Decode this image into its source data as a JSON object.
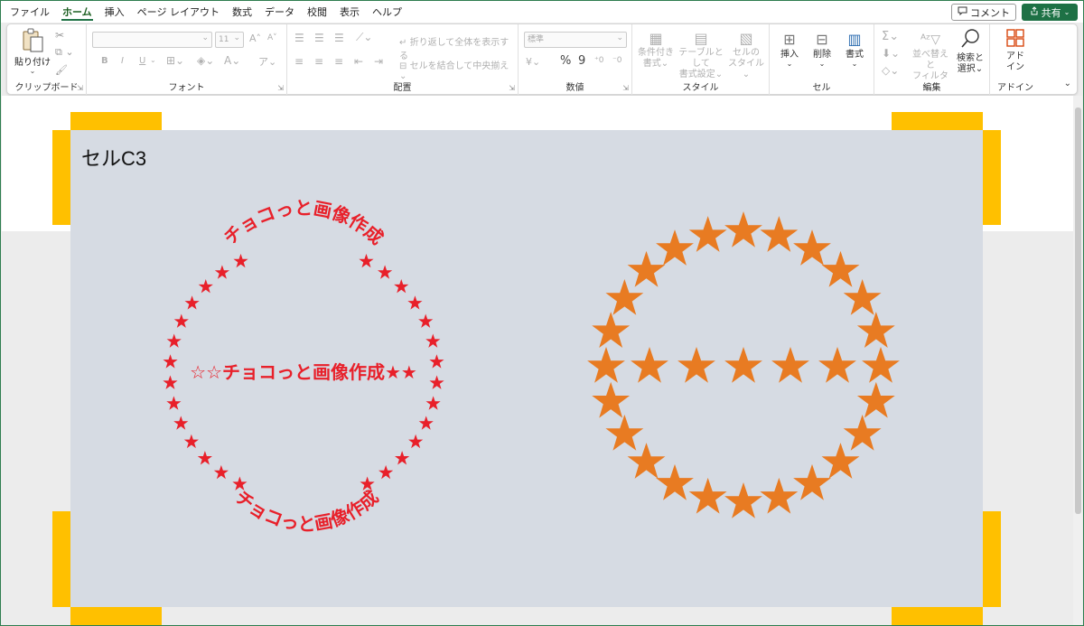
{
  "menu": {
    "tabs": [
      {
        "label": "ファイル"
      },
      {
        "label": "ホーム"
      },
      {
        "label": "挿入"
      },
      {
        "label": "ページ レイアウト"
      },
      {
        "label": "数式"
      },
      {
        "label": "データ"
      },
      {
        "label": "校閲"
      },
      {
        "label": "表示"
      },
      {
        "label": "ヘルプ"
      }
    ],
    "active_tab": "ホーム",
    "comment_label": "コメント",
    "share_label": "共有"
  },
  "ribbon": {
    "clipboard": {
      "paste_label": "貼り付け",
      "group_label": "クリップボード"
    },
    "font": {
      "font_size": "11",
      "bold": "B",
      "italic": "I",
      "underline": "U",
      "grow": "A",
      "shrink": "A",
      "group_label": "フォント"
    },
    "alignment": {
      "wrap_label": "折り返して全体を表示する",
      "merge_label": "セルを結合して中央揃え",
      "group_label": "配置"
    },
    "number": {
      "format": "標準",
      "percent": "%",
      "comma": "9",
      "group_label": "数値"
    },
    "styles": {
      "conditional_label_1": "条件付き",
      "conditional_label_2": "書式",
      "table_label_1": "テーブルとして",
      "table_label_2": "書式設定",
      "cell_styles_label_1": "セルの",
      "cell_styles_label_2": "スタイル",
      "group_label": "スタイル"
    },
    "cells": {
      "insert_label": "挿入",
      "delete_label": "削除",
      "format_label": "書式",
      "group_label": "セル"
    },
    "editing": {
      "sort_label_1": "並べ替えと",
      "sort_label_2": "フィルター",
      "find_label_1": "検索と",
      "find_label_2": "選択",
      "group_label": "編集"
    },
    "addins": {
      "label_1": "アド",
      "label_2": "イン",
      "group_label": "アドイン"
    }
  },
  "sheet": {
    "cell_label": "セルC3",
    "badge_text_top": "チョコっと画像作成",
    "badge_text_middle": "☆☆チョコっと画像作成★★",
    "badge_text_bottom": "チョコっと画像作成"
  },
  "colors": {
    "accent_green": "#217346",
    "share_green": "#1e7145",
    "handle_yellow": "#ffc000",
    "shape_fill": "#d6dbe3",
    "red_badge": "#e8202a",
    "orange_stars": "#e87b22"
  },
  "icons": {
    "paste": "clipboard-icon",
    "cut": "scissors-icon",
    "copy": "copy-icon",
    "format_painter": "brush-icon",
    "find": "magnifier-icon",
    "comment": "comment-icon",
    "share": "share-icon",
    "addins": "grid-icon",
    "collapse": "chevron-up-icon"
  }
}
